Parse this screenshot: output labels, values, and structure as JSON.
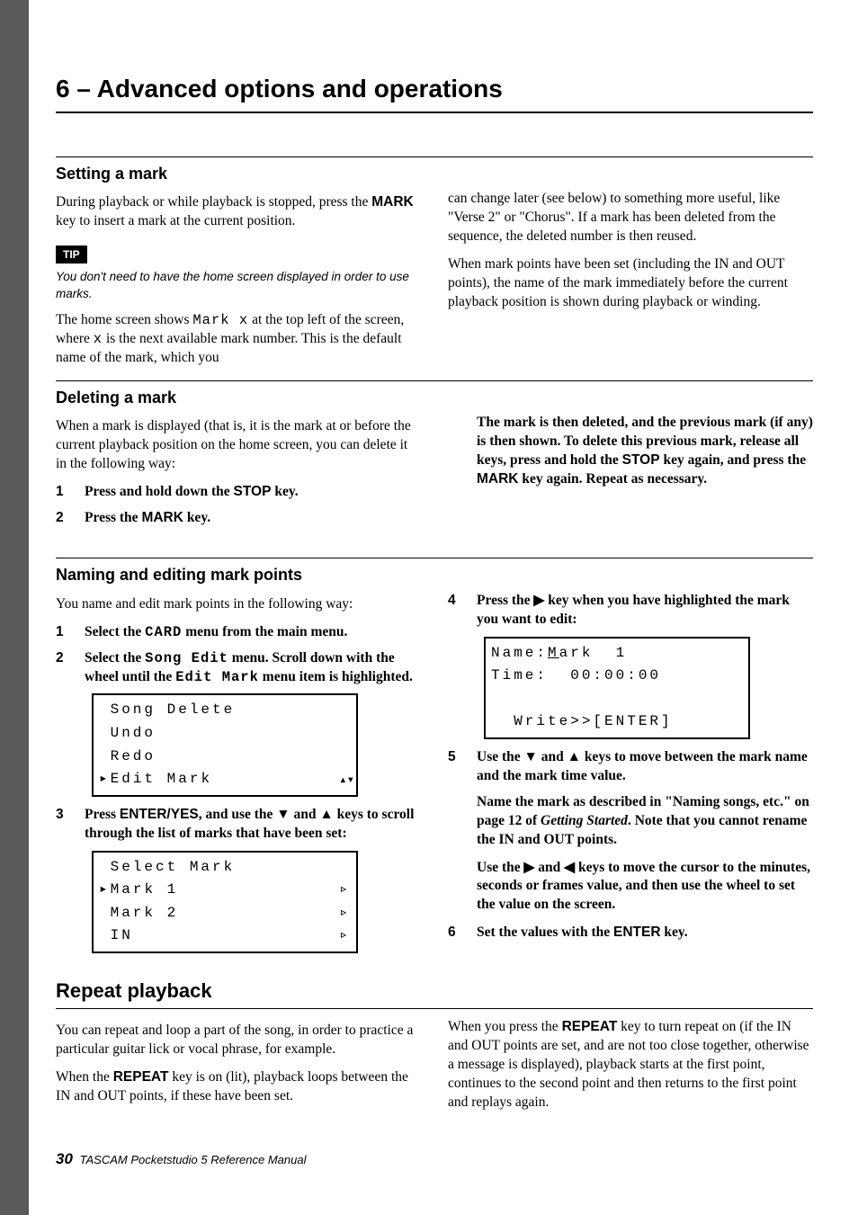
{
  "chapter_title": "6 – Advanced options and operations",
  "setting_mark": {
    "heading": "Setting a mark",
    "p1a": "During playback or while playback is stopped, press the ",
    "p1_key": "MARK",
    "p1b": " key to insert a mark at the current position.",
    "tip_label": "TIP",
    "tip_text": "You don't need to have the home screen displayed in order to use marks.",
    "p2a": "The home screen shows ",
    "p2_mono1": "Mark x",
    "p2b": " at the top left of the screen, where ",
    "p2_mono2": "x",
    "p2c": " is the next available mark number. This is the default name of the mark, which you",
    "p3": "can change later (see below) to something more useful, like \"Verse 2\" or \"Chorus\". If a mark has been deleted from the sequence, the deleted number is then reused.",
    "p4": "When mark points have been set (including the IN and OUT points), the name of the mark immediately before the current playback position is shown during playback or winding."
  },
  "deleting_mark": {
    "heading": "Deleting a mark",
    "p1": "When a mark is displayed (that is, it is the mark at or before the current playback position on the home screen, you can delete it in the following way:",
    "s1_num": "1",
    "s1a": "Press and hold down the ",
    "s1_key": "STOP",
    "s1b": " key.",
    "s2_num": "2",
    "s2a": "Press the ",
    "s2_key": "MARK",
    "s2b": " key.",
    "p2a": "The mark is then deleted, and the previous mark (if any) is then shown. To delete this previous mark, release all keys, press and hold the ",
    "p2_key1": "STOP",
    "p2b": " key again, and press the ",
    "p2_key2": "MARK",
    "p2c": " key again. Repeat as necessary."
  },
  "naming": {
    "heading": "Naming and editing mark points",
    "p1": "You name and edit mark points in the following way:",
    "s1_num": "1",
    "s1a": "Select the ",
    "s1_mono": "CARD",
    "s1b": " menu from the main menu.",
    "s2_num": "2",
    "s2a": "Select the ",
    "s2_mono1": "Song Edit",
    "s2b": " menu. Scroll down with the wheel until the ",
    "s2_mono2": "Edit Mark",
    "s2c": " menu item is highlighted.",
    "lcd1_l1": " Song Delete",
    "lcd1_l2": " Undo",
    "lcd1_l3": " Redo",
    "lcd1_l4": "▸Edit Mark",
    "s3_num": "3",
    "s3a": "Press ",
    "s3_key": "ENTER/YES",
    "s3b": ", and use the ▼ and ▲ keys to scroll through the list of marks that have been set:",
    "lcd2_l1": " Select Mark",
    "lcd2_l2": "▸Mark 1",
    "lcd2_l3": " Mark 2",
    "lcd2_l4": " IN",
    "lcd2_arr": "▹",
    "s4_num": "4",
    "s4": "Press the ▶ key when you have highlighted the mark you want to edit:",
    "lcd3_l1a": "Name:",
    "lcd3_l1b": "M",
    "lcd3_l1c": "ark  1",
    "lcd3_l2": "Time:  00:00:00",
    "lcd3_l3": "  Write>>[ENTER]",
    "s5_num": "5",
    "s5": "Use the ▼ and ▲ keys to move between the mark name and the mark time value.",
    "s5_p1a": "Name the mark as described in \"Naming songs, etc.\" on page 12 of ",
    "s5_em": "Getting Started",
    "s5_p1b": ". Note that you cannot rename the IN and OUT points.",
    "s5_p2": "Use the ▶ and ◀ keys to move the cursor to the minutes, seconds or frames value, and then use the wheel to set the value on the screen.",
    "s6_num": "6",
    "s6a": "Set the values with the ",
    "s6_key": "ENTER",
    "s6b": " key."
  },
  "repeat": {
    "heading": "Repeat playback",
    "p1": "You can repeat and loop a part of the song, in order to practice a particular guitar lick or vocal phrase, for example.",
    "p2a": "When the ",
    "p2_key": "REPEAT",
    "p2b": " key is on (lit), playback loops between the IN and OUT points, if these have been set.",
    "p3a": "When you press the ",
    "p3_key": "REPEAT",
    "p3b": " key to turn repeat on (if the IN and OUT points are set, and are not too close together, otherwise a message is displayed), playback starts at the first point, continues to the second point and then returns to the first point and replays again."
  },
  "footer": {
    "page_number": "30",
    "text": " TASCAM Pocketstudio 5 Reference Manual"
  }
}
